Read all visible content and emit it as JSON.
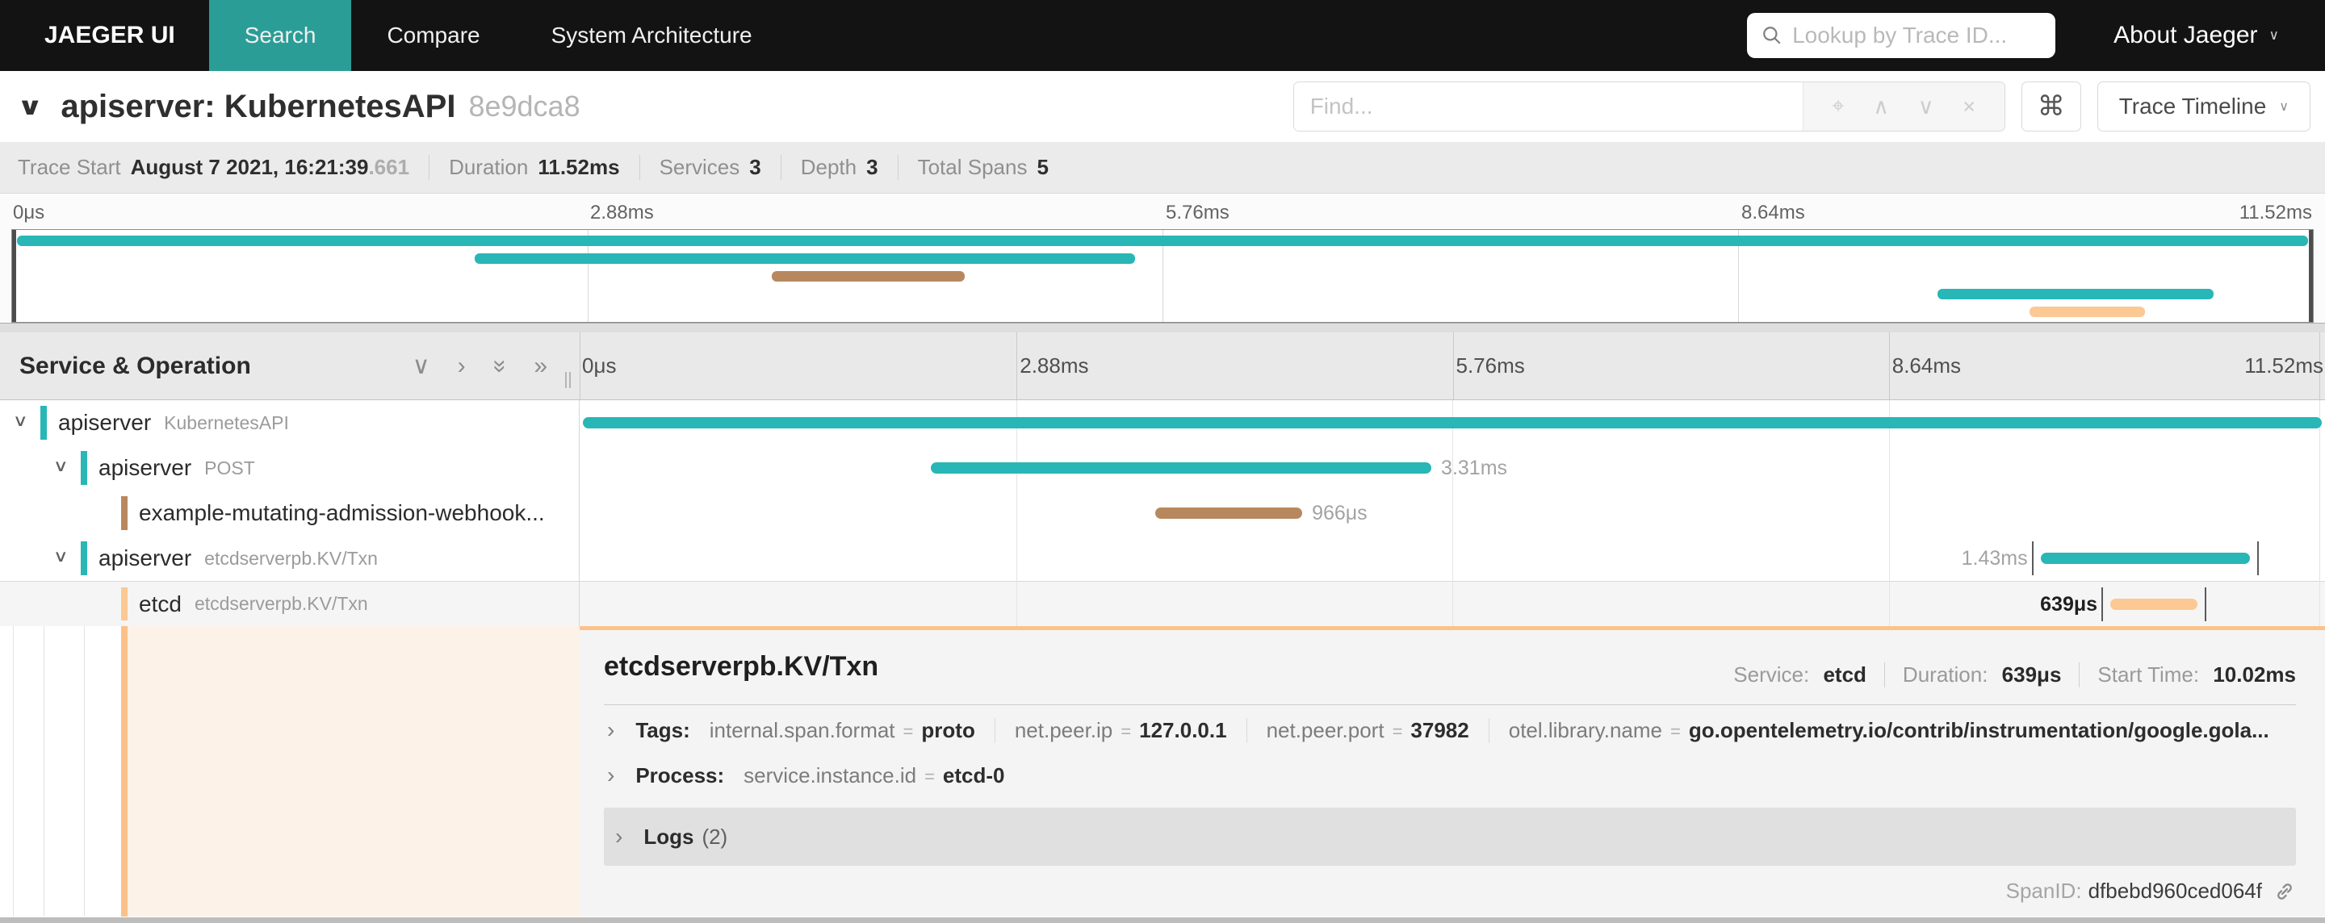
{
  "nav": {
    "brand": "JAEGER UI",
    "items": [
      {
        "label": "Search",
        "active": true
      },
      {
        "label": "Compare",
        "active": false
      },
      {
        "label": "System Architecture",
        "active": false
      }
    ],
    "lookup_placeholder": "Lookup by Trace ID...",
    "about_label": "About Jaeger"
  },
  "trace_header": {
    "title": "apiserver: KubernetesAPI",
    "trace_id": "8e9dca8",
    "find_placeholder": "Find...",
    "shortcut_glyph": "⌘",
    "view_label": "Trace Timeline"
  },
  "summary": {
    "items": [
      {
        "label": "Trace Start",
        "value": "August 7 2021, 16:21:39",
        "suffix": ".661"
      },
      {
        "label": "Duration",
        "value": "11.52ms",
        "suffix": ""
      },
      {
        "label": "Services",
        "value": "3",
        "suffix": ""
      },
      {
        "label": "Depth",
        "value": "3",
        "suffix": ""
      },
      {
        "label": "Total Spans",
        "value": "5",
        "suffix": ""
      }
    ]
  },
  "timeline": {
    "left_header": "Service & Operation",
    "ticks": [
      "0μs",
      "2.88ms",
      "5.76ms",
      "8.64ms",
      "11.52ms"
    ],
    "total_duration": "11.52ms"
  },
  "spans": [
    {
      "service": "apiserver",
      "operation": "KubernetesAPI",
      "level": 0,
      "has_children": true,
      "color": "#29b6b6",
      "start_pct": 0.2,
      "width_pct": 99.6,
      "duration_label": "",
      "label_side": "right",
      "selected": false,
      "edge_ticks": false
    },
    {
      "service": "apiserver",
      "operation": "POST",
      "level": 1,
      "has_children": true,
      "color": "#29b6b6",
      "start_pct": 20.1,
      "width_pct": 28.7,
      "duration_label": "3.31ms",
      "label_side": "right",
      "selected": false,
      "edge_ticks": false
    },
    {
      "service": "example-mutating-admission-webhook...",
      "operation": "",
      "level": 2,
      "has_children": false,
      "color": "#b7885e",
      "start_pct": 33.0,
      "width_pct": 8.4,
      "duration_label": "966μs",
      "label_side": "right",
      "selected": false,
      "edge_ticks": false
    },
    {
      "service": "apiserver",
      "operation": "etcdserverpb.KV/Txn",
      "level": 1,
      "has_children": true,
      "color": "#29b6b6",
      "start_pct": 83.7,
      "width_pct": 12.0,
      "duration_label": "1.43ms",
      "label_side": "left",
      "selected": false,
      "edge_ticks": true
    },
    {
      "service": "etcd",
      "operation": "etcdserverpb.KV/Txn",
      "level": 2,
      "has_children": false,
      "color": "#fcc893",
      "start_pct": 87.7,
      "width_pct": 5.0,
      "duration_label": "639μs",
      "label_side": "left",
      "selected": true,
      "edge_ticks": true
    }
  ],
  "detail": {
    "title": "etcdserverpb.KV/Txn",
    "meta": [
      {
        "label": "Service:",
        "value": "etcd"
      },
      {
        "label": "Duration:",
        "value": "639μs"
      },
      {
        "label": "Start Time:",
        "value": "10.02ms"
      }
    ],
    "tags_label": "Tags:",
    "tags": [
      {
        "key": "internal.span.format",
        "value": "proto"
      },
      {
        "key": "net.peer.ip",
        "value": "127.0.0.1"
      },
      {
        "key": "net.peer.port",
        "value": "37982"
      },
      {
        "key": "otel.library.name",
        "value": "go.opentelemetry.io/contrib/instrumentation/google.gola..."
      }
    ],
    "process_label": "Process:",
    "process": [
      {
        "key": "service.instance.id",
        "value": "etcd-0"
      }
    ],
    "logs_label": "Logs",
    "logs_count": "(2)",
    "spanid_label": "SpanID:",
    "spanid_value": "dfbebd960ced064f"
  },
  "icons": {
    "down": "∨",
    "up": "∧",
    "right": "›",
    "double": "»",
    "target": "⌖",
    "clear": "×"
  },
  "colors": {
    "accent_teal": "#2a9d96",
    "span_teal": "#29b6b6",
    "span_brown": "#b7885e",
    "span_peach": "#fcc893",
    "selected_row_bg": "#f5f5f5",
    "detail_border": "#fcc28b"
  }
}
